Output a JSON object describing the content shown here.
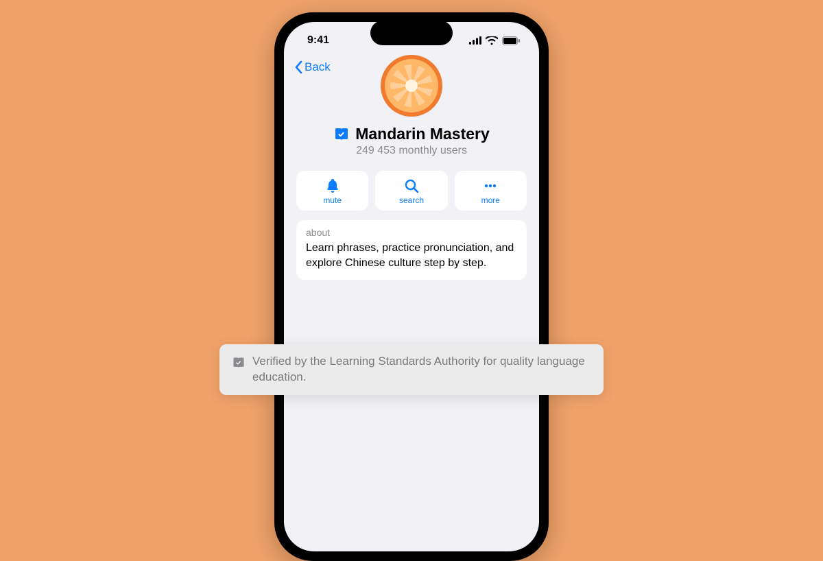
{
  "status": {
    "time": "9:41"
  },
  "nav": {
    "back_label": "Back"
  },
  "profile": {
    "name": "Mandarin Mastery",
    "subtitle": "249 453 monthly users"
  },
  "actions": {
    "mute": "mute",
    "search": "search",
    "more": "more"
  },
  "about": {
    "label": "about",
    "text": "Learn phrases, practice pronunciation, and explore Chinese culture step by step."
  },
  "callout": {
    "text": "Verified by the Learning Standards Authority for quality language education."
  }
}
